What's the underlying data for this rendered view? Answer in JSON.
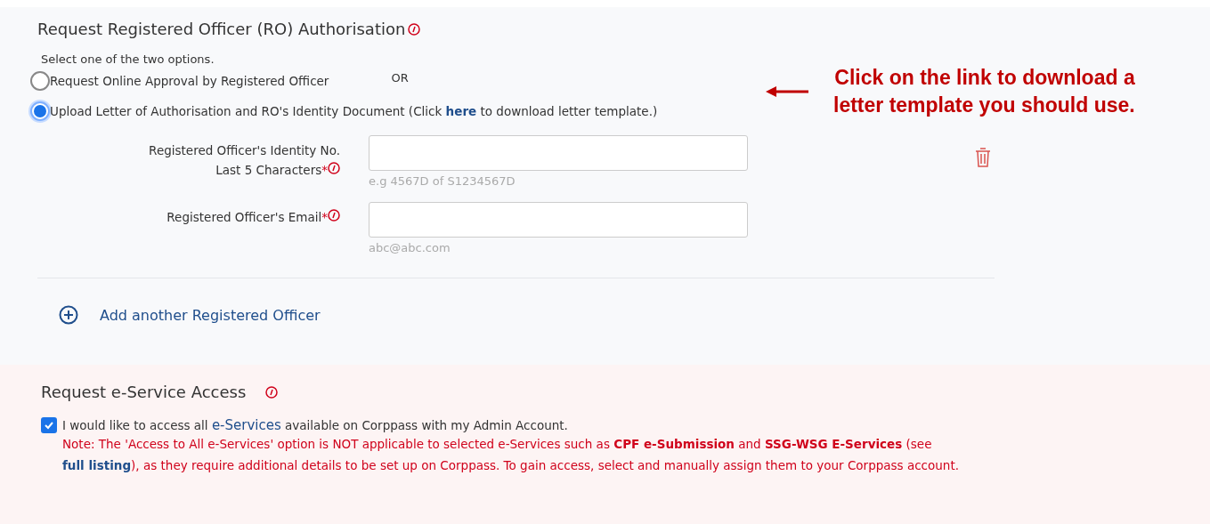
{
  "ro_section": {
    "title": "Request Registered Officer (RO) Authorisation",
    "instruction": "Select one of the two options.",
    "options": [
      {
        "kind": "plain",
        "label": "Request Online Approval by Registered Officer",
        "selected": false
      },
      {
        "kind": "link",
        "before": "Upload Letter of Authorisation and RO's Identity Document (Click ",
        "link": "here",
        "after": " to download letter template.)",
        "selected": true
      }
    ],
    "or_label": "OR",
    "fields": [
      {
        "label_lines": [
          "Registered Officer's Identity No.",
          "Last 5 Characters"
        ],
        "required": "*",
        "hint": "e.g 4567D of S1234567D"
      },
      {
        "label_lines": [
          "Registered Officer's Email"
        ],
        "required": "*",
        "hint": "abc@abc.com"
      }
    ],
    "add_button": "Add another Registered Officer"
  },
  "annotation": {
    "lines": [
      "Click on the link to download a",
      "letter template you should use."
    ]
  },
  "eservice_section": {
    "title": "Request e-Service Access",
    "checkbox": {
      "checked": true,
      "before": "I would like to access all ",
      "link": "e-Services",
      "after": " available on Corppass with my Admin Account."
    },
    "note": [
      {
        "kind": "text",
        "text": "Note: The 'Access to All e-Services' option is NOT applicable to selected e-Services such as "
      },
      {
        "kind": "bold",
        "text": "CPF e-Submission"
      },
      {
        "kind": "text",
        "text": " and "
      },
      {
        "kind": "bold",
        "text": "SSG-WSG E-Services"
      },
      {
        "kind": "text",
        "text": " (see "
      },
      {
        "kind": "link",
        "text": "full listing"
      },
      {
        "kind": "text",
        "text": "), as they require additional details to be set up on Corppass. To gain access, select and manually assign them to your Corppass account."
      }
    ]
  }
}
